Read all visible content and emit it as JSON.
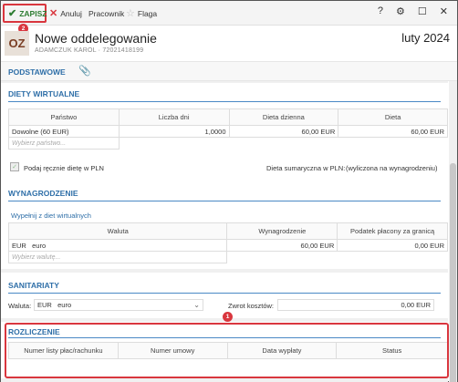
{
  "toolbar": {
    "save_label": "ZAPISZ",
    "cancel_label": "Anuluj",
    "worker_label": "Pracownik",
    "flag_label": "Flaga",
    "help_icon": "?",
    "settings_icon": "⚙",
    "restore_icon": "☐",
    "close_icon": "✕"
  },
  "header": {
    "avatar": "OZ",
    "title": "Nowe oddelegowanie",
    "subtitle": "ADAMCZUK KAROL  ·  72021418199",
    "date": "luty 2024"
  },
  "tabs": {
    "active": "PODSTAWOWE"
  },
  "virtual_diets": {
    "title": "DIETY WIRTUALNE",
    "columns": [
      "Państwo",
      "Liczba dni",
      "Dieta dzienna",
      "Dieta"
    ],
    "row": {
      "country": "Dowolne (60 EUR)",
      "days": "1,0000",
      "daily": "60,00 EUR",
      "total": "60,00 EUR"
    },
    "placeholder": "Wybierz państwo...",
    "manual_label": "Podaj ręcznie dietę w PLN",
    "sum_label": "Dieta sumaryczna w PLN:",
    "sum_value": "(wyliczona na wynagrodzeniu)"
  },
  "salary": {
    "title": "WYNAGRODZENIE",
    "fill_link": "Wypełnij z diet wirtualnych",
    "columns": [
      "Waluta",
      "Wynagrodzenie",
      "Podatek płacony za granicą"
    ],
    "row": {
      "currency_code": "EUR",
      "currency_name": "euro",
      "salary": "60,00 EUR",
      "tax": "0,00 EUR"
    },
    "placeholder": "Wybierz walutę..."
  },
  "sanitary": {
    "title": "SANITARIATY",
    "currency_label": "Waluta:",
    "currency_code": "EUR",
    "currency_name": "euro",
    "refund_label": "Zwrot kosztów:",
    "refund_value": "0,00 EUR"
  },
  "settlement": {
    "title": "ROZLICZENIE",
    "columns": [
      "Numer listy płac/rachunku",
      "Numer umowy",
      "Data wypłaty",
      "Status"
    ]
  },
  "badges": {
    "b1": "1",
    "b2": "2"
  },
  "colors": {
    "accent": "#2f6fa8",
    "highlight": "#d9363e",
    "save": "#2e7d32"
  }
}
